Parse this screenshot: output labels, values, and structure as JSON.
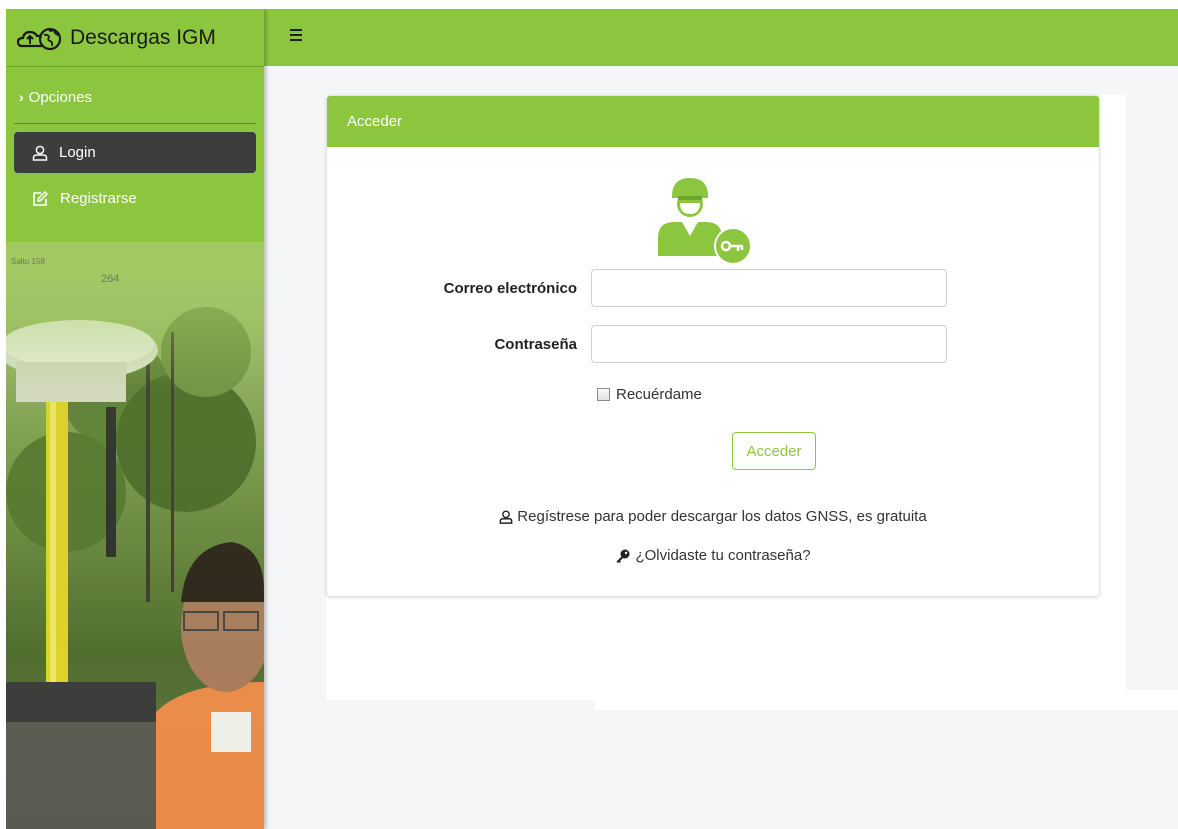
{
  "brand": {
    "title": "Descargas IGM",
    "logo_icon": "cloud-globe-icon"
  },
  "sidebar": {
    "section_label": "Opciones",
    "items": [
      {
        "label": "Login",
        "icon": "user-icon",
        "active": true
      },
      {
        "label": "Registrarse",
        "icon": "edit-icon",
        "active": false
      }
    ]
  },
  "topbar": {
    "menu_icon": "hamburger-icon"
  },
  "panel": {
    "title": "Acceder",
    "email_label": "Correo electrónico",
    "email_value": "",
    "password_label": "Contraseña",
    "password_value": "",
    "remember_label": "Recuérdame",
    "submit_label": "Acceder",
    "register_text": "Regístrese para poder descargar los datos GNSS, es gratuita",
    "forgot_text": "¿Olvidaste tu contraseña?"
  },
  "colors": {
    "brand_green": "#8cc63f",
    "active_item": "#3d3d3d",
    "background": "#f5f6f8"
  }
}
